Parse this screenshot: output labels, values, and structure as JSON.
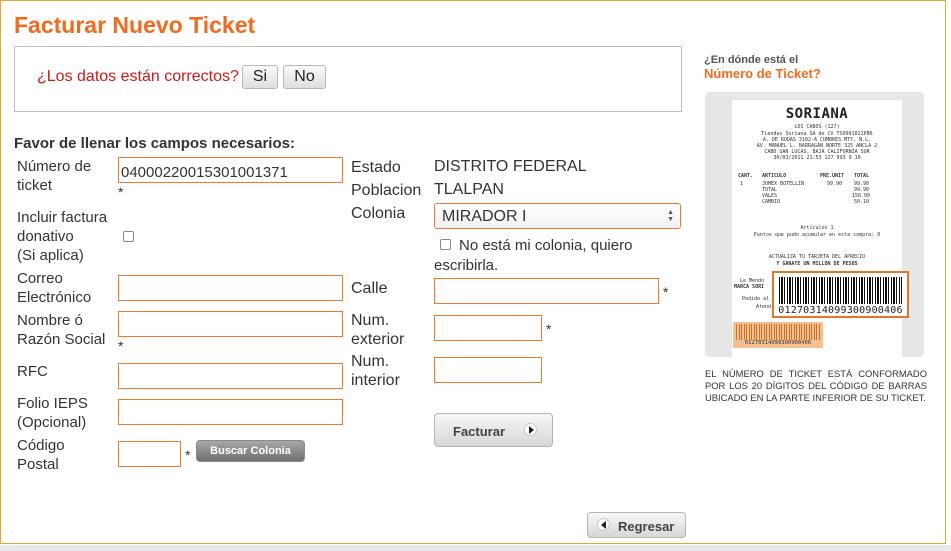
{
  "title": "Facturar Nuevo Ticket",
  "confirm": {
    "question": "¿Los datos están correctos?",
    "yes": "Si",
    "no": "No"
  },
  "section_title": "Favor de llenar los campos necesarios:",
  "left_labels": {
    "ticket_l1": "Número de",
    "ticket_l2": "ticket",
    "donativo_l1": "Incluir factura",
    "donativo_l2": "donativo",
    "donativo_l3": "(Si aplica)",
    "correo_l1": "Correo",
    "correo_l2": "Electrónico",
    "nombre_l1": "Nombre ó",
    "nombre_l2": "Razón Social",
    "rfc": "RFC",
    "folio_l1": "Folio IEPS",
    "folio_l2": "(Opcional)",
    "cp_l1": "Código",
    "cp_l2": "Postal"
  },
  "fields": {
    "ticket_number": "04000220015301001371",
    "correo": "",
    "nombre": "",
    "rfc": "",
    "folio": "",
    "cp": "",
    "calle": "",
    "num_ext": "",
    "num_int": ""
  },
  "required_mark": "*",
  "buscar_colonia": "Buscar Colonia",
  "right_labels": {
    "estado": "Estado",
    "poblacion": "Poblacion",
    "colonia": "Colonia",
    "calle": "Calle",
    "num_ext_l1": "Num.",
    "num_ext_l2": "exterior",
    "num_int_l1": "Num.",
    "num_int_l2": "interior"
  },
  "values": {
    "estado": "DISTRITO FEDERAL",
    "poblacion": "TLALPAN"
  },
  "colonia_selected": "MIRADOR I",
  "no_colonia_l1": "No está mi colonia, quiero",
  "no_colonia_l2": "escribirla.",
  "facturar": "Facturar",
  "regresar": "Regresar",
  "help": {
    "q1": "¿En dónde está el",
    "q2": "Número de Ticket?",
    "desc": "EL NÚMERO DE TICKET ESTÁ CONFORMADO POR LOS 20 DÍGITOS DEL CÓDIGO DE BARRAS UBICADO EN LA PARTE INFERIOR DE SU TICKET."
  },
  "ticket_image": {
    "brand": "SORIANA",
    "store": "LOS CABOS (127)",
    "company": "Tiendas Soriana SA de CV TSO991022PB6",
    "address1": "A. DE RODAS 3102-A CUMBRES MTY, N.L.",
    "address2": "AV. MANUEL L. BARRAGÁN NORTE 325 ANCLA 2",
    "address3": "CABO SAN LUCAS, BAJA CALIFORNIA SUR",
    "datetime": "30/03/2011 21:53 127 993 9 10",
    "col_cant": "CANT.",
    "col_art": "ARTICULO",
    "col_pre": "PRE.UNIT",
    "col_tot": "TOTAL",
    "item_qty": "1",
    "item_name": "JUMEX BOTELLIN",
    "item_price": "99.90",
    "item_total": "99.90",
    "total_label": "TOTAL",
    "total_val": "99.90",
    "vales_label": "VALES",
    "vales_val": "150.00",
    "cambio_label": "CAMBIO",
    "cambio_val": "50.10",
    "articulos": "Artículos 1",
    "puntos": "Puntos que pudo acumular en esta compra: 0",
    "promo1": "ACTUALIZA TU TARJETA DEL APRECIO",
    "promo2": "Y GANATE UN MILLON DE PESOS",
    "side1": "Le Mendo",
    "side2": "MARCA SORI",
    "side3": "Pedido al",
    "side4": "Atend",
    "barcode": "01270314099300900406",
    "barcode_small": "01270314099300900406"
  }
}
